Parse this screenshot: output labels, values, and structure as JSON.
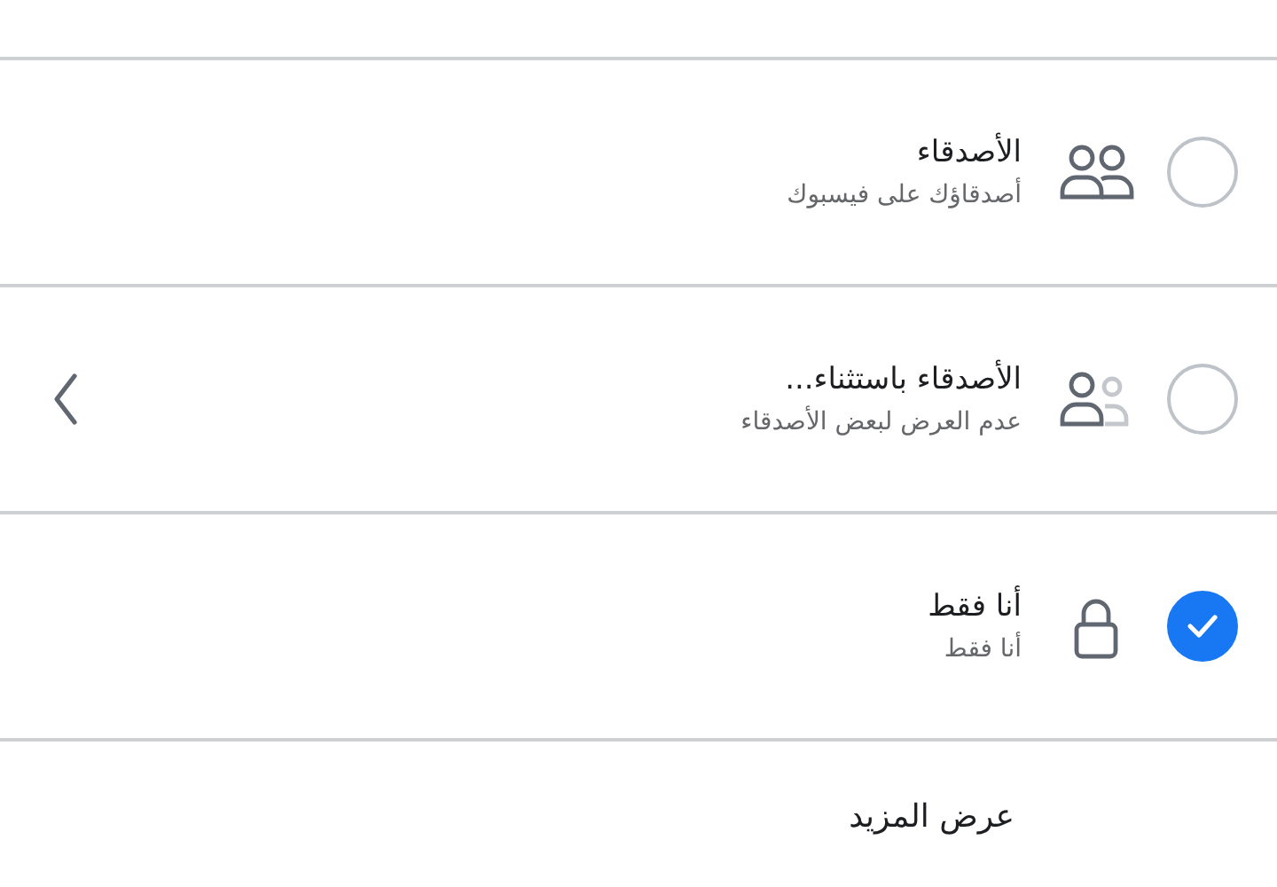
{
  "options": [
    {
      "title": "الأصدقاء",
      "subtitle": "أصدقاؤك على فيسبوك",
      "kind": "friends",
      "selected": false,
      "has_submenu": false
    },
    {
      "title": "الأصدقاء باستثناء...",
      "subtitle": "عدم العرض لبعض الأصدقاء",
      "kind": "friends-except",
      "selected": false,
      "has_submenu": true
    },
    {
      "title": "أنا فقط",
      "subtitle": "أنا فقط",
      "kind": "lock",
      "selected": true,
      "has_submenu": false
    }
  ],
  "see_more": "عرض المزيد"
}
